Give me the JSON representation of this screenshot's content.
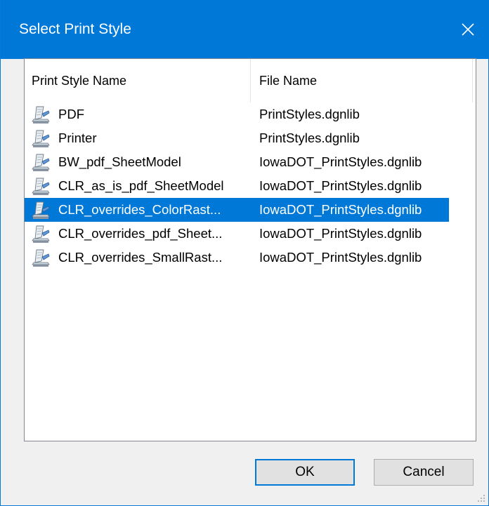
{
  "dialog": {
    "title": "Select Print Style",
    "close_icon": "close-icon",
    "colors": {
      "titlebar": "#0078d7",
      "selection": "#0078d7"
    }
  },
  "list": {
    "columns": [
      "Print Style Name",
      "File Name"
    ],
    "rows": [
      {
        "name": "PDF",
        "file": "PrintStyles.dgnlib",
        "icon": "print-style-icon",
        "selected": false
      },
      {
        "name": "Printer",
        "file": "PrintStyles.dgnlib",
        "icon": "print-style-icon",
        "selected": false
      },
      {
        "name": "BW_pdf_SheetModel",
        "file": "IowaDOT_PrintStyles.dgnlib",
        "icon": "print-style-icon",
        "selected": false
      },
      {
        "name": "CLR_as_is_pdf_SheetModel",
        "file": "IowaDOT_PrintStyles.dgnlib",
        "icon": "print-style-icon",
        "selected": false
      },
      {
        "name": "CLR_overrides_ColorRast...",
        "file": "IowaDOT_PrintStyles.dgnlib",
        "icon": "print-style-icon",
        "selected": true
      },
      {
        "name": "CLR_overrides_pdf_Sheet...",
        "file": "IowaDOT_PrintStyles.dgnlib",
        "icon": "print-style-icon",
        "selected": false
      },
      {
        "name": "CLR_overrides_SmallRast...",
        "file": "IowaDOT_PrintStyles.dgnlib",
        "icon": "print-style-icon",
        "selected": false
      }
    ]
  },
  "buttons": {
    "ok_label": "OK",
    "cancel_label": "Cancel"
  }
}
